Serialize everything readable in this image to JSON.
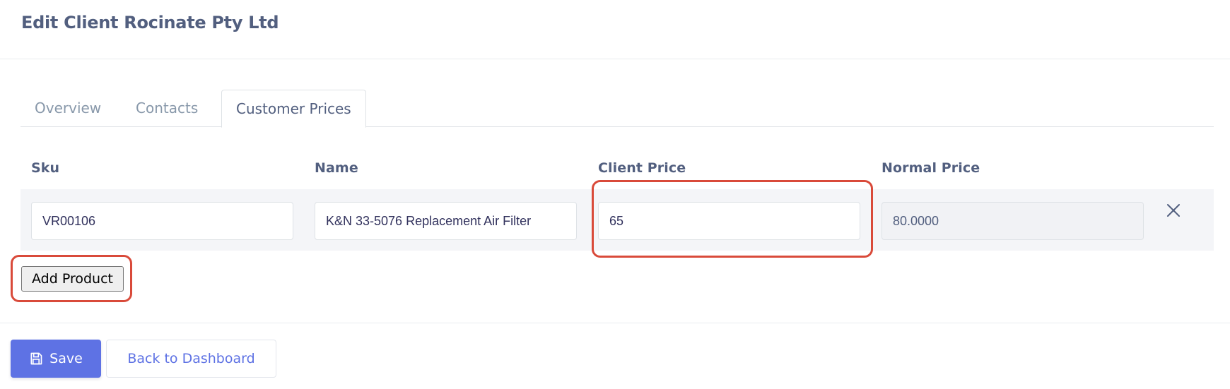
{
  "page": {
    "title": "Edit Client Rocinate Pty Ltd"
  },
  "tabs": [
    {
      "label": "Overview"
    },
    {
      "label": "Contacts"
    },
    {
      "label": "Customer Prices"
    }
  ],
  "active_tab": "Customer Prices",
  "table": {
    "columns": [
      "Sku",
      "Name",
      "Client Price",
      "Normal Price"
    ],
    "rows": [
      {
        "sku": "VR00106",
        "name": "K&N 33-5076 Replacement Air Filter",
        "client_price": "65",
        "normal_price": "80.0000"
      }
    ]
  },
  "buttons": {
    "add_product": "Add Product",
    "save": "Save",
    "back": "Back to Dashboard"
  },
  "icons": {
    "remove": "close-icon",
    "save": "floppy-disk-icon"
  },
  "colors": {
    "primary": "#5e72e4",
    "highlight": "#d94a3a"
  }
}
